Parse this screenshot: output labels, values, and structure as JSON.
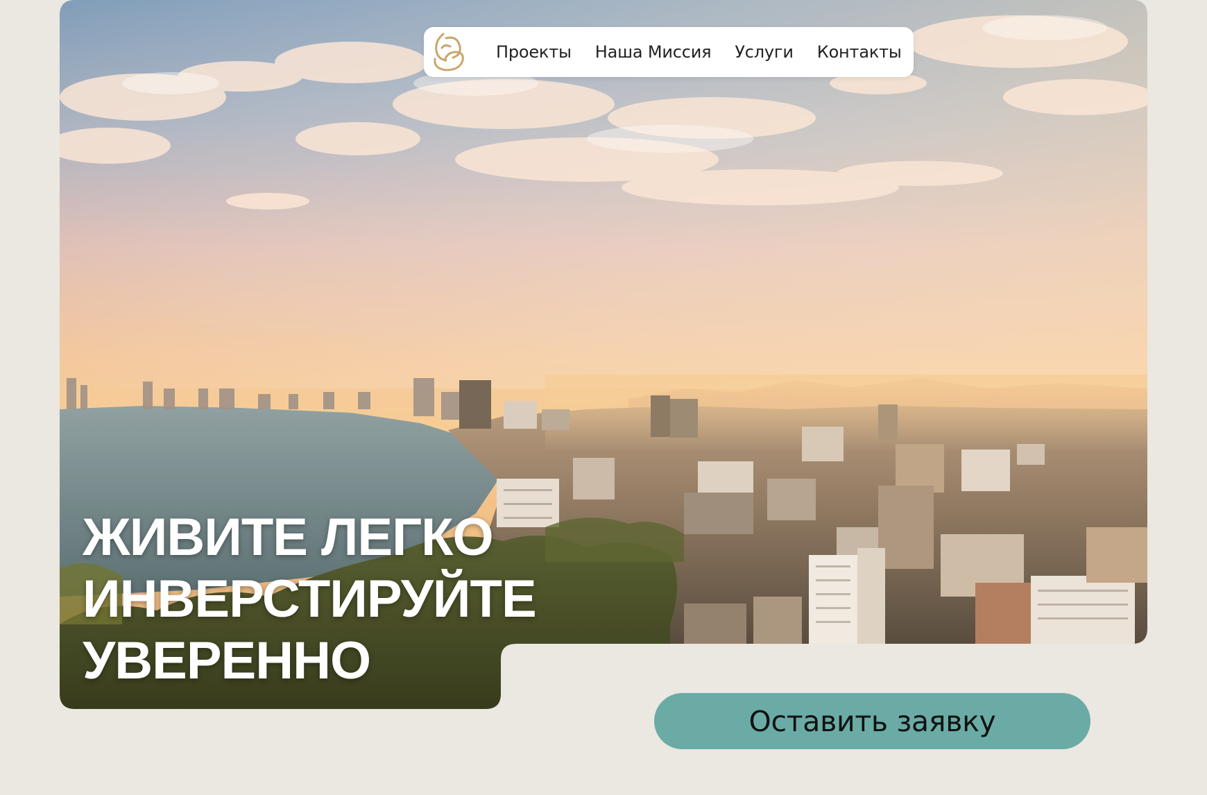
{
  "nav": {
    "logo_icon": "swirl-logo-icon",
    "links": [
      "Проекты",
      "Наша Миссия",
      "Услуги",
      "Контакты"
    ]
  },
  "hero": {
    "image": "coastal-city-sunset-photo",
    "headline": [
      "ЖИВИТЕ ЛЕГКО",
      "ИНВЕРСТИРУЙТЕ",
      "УВЕРЕННО"
    ]
  },
  "cta": {
    "label": "Оставить заявку"
  },
  "colors": {
    "background": "#ebe7e1",
    "nav_background": "#ffffff",
    "cta_background": "#6aaba6",
    "logo_gold": "#c9a66b",
    "headline_text": "#ffffff"
  }
}
